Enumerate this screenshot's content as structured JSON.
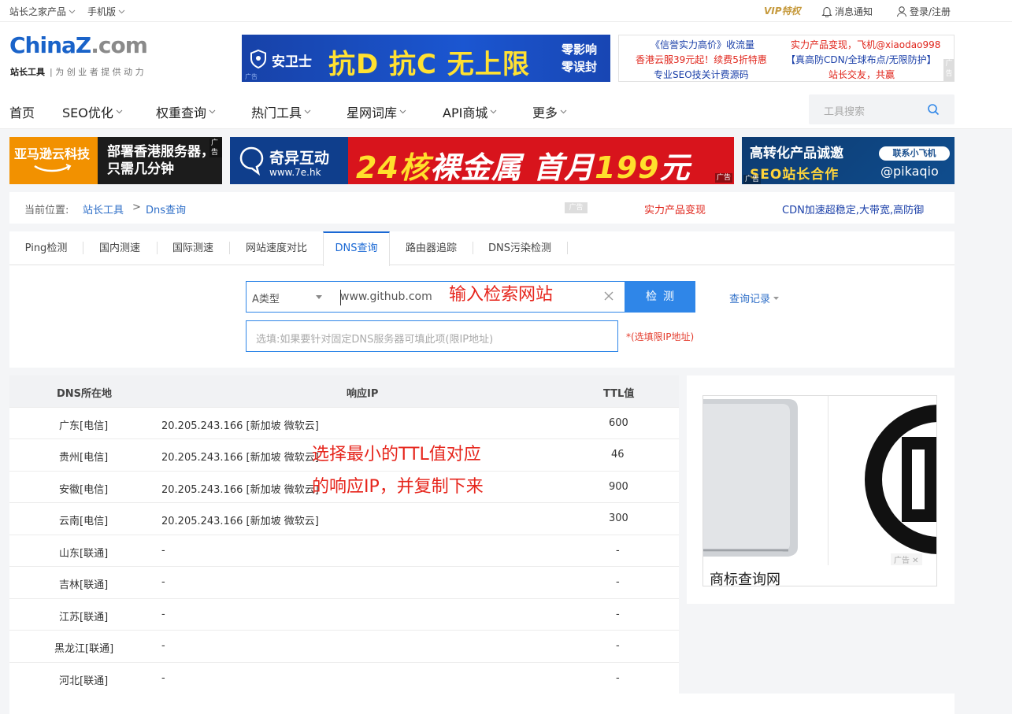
{
  "topbar": {
    "left_items": [
      "站长之家产品",
      "手机版"
    ],
    "vip": "VIP特权",
    "notify": "消息通知",
    "login": "登录/注册"
  },
  "logo": {
    "part1": "China",
    "part2": "Z",
    "part3": ".com",
    "sub_bold": "站长工具",
    "sub_text": "| 为 创 业 者 提 供 动 力"
  },
  "ads": {
    "top_banner": {
      "brand": "安卫士",
      "slogan": "抗D 抗C 无上限",
      "side1": "零影响",
      "side2": "零误封",
      "tag": "广告"
    },
    "text_links": [
      {
        "text": "《信誉实力高价》收流量",
        "color": "#1a3fa8"
      },
      {
        "text": "实力产品变现，飞机@xiaodao998",
        "color": "#e0251b"
      },
      {
        "text": "香港云服39元起！续费5折特惠",
        "color": "#e0251b"
      },
      {
        "text": "【真高防CDN/全球布点/无限防护】",
        "color": "#1a3fa8"
      },
      {
        "text": "专业SEO技关计费源码",
        "color": "#1a3fa8"
      },
      {
        "text": "站长交友，共赢",
        "color": "#e0251b"
      }
    ],
    "text_ad_mark": "广告",
    "banner1": {
      "t1": "亚马逊云科技",
      "t2a": "部署香港服务器，",
      "t2b": "只需几分钟",
      "tag": "广告"
    },
    "banner2": {
      "name": "奇异互动",
      "url": "www.7e.hk",
      "big1": "24核",
      "big2": "裸金属  首月",
      "big3": "199",
      "big4": "元",
      "tag": "广告"
    },
    "banner3": {
      "t1": "高转化产品诚邀",
      "t2": "SEO站长合作",
      "tg": "联系小飞机",
      "tw": "@pikaqio",
      "tag": "广告"
    }
  },
  "nav": {
    "items": [
      "首页",
      "SEO优化",
      "权重查询",
      "热门工具",
      "星网词库",
      "API商城",
      "更多"
    ],
    "search_placeholder": "工具搜索"
  },
  "breadcrumb": {
    "label": "当前位置:",
    "link1": "站长工具",
    "sep": ">",
    "link2": "Dns查询",
    "ad_mark": "广告",
    "promo1": "实力产品变现",
    "promo2": "CDN加速超稳定,大带宽,高防御"
  },
  "tabs": [
    "Ping检测",
    "国内测速",
    "国际测速",
    "网站速度对比",
    "DNS查询",
    "路由器追踪",
    "DNS污染检测"
  ],
  "form": {
    "record_type": "A类型",
    "domain": "www.github.com",
    "submit": "检测",
    "history": "查询记录",
    "dns_placeholder": "选填:如果要针对固定DNS服务器可填此项(限IP地址)",
    "dns_note": "*(选填限IP地址)"
  },
  "annotations": {
    "input_hint": "输入检索网站",
    "pick_line1": "选择最小的TTL值对应",
    "pick_line2": "的响应IP，并复制下来"
  },
  "table": {
    "headers": [
      "DNS所在地",
      "响应IP",
      "TTL值"
    ],
    "rows": [
      {
        "loc": "广东[电信]",
        "ip": "20.205.243.166 [新加坡 微软云]",
        "ttl": "600"
      },
      {
        "loc": "贵州[电信]",
        "ip": "20.205.243.166 [新加坡 微软云]",
        "ttl": "46"
      },
      {
        "loc": "安徽[电信]",
        "ip": "20.205.243.166 [新加坡 微软云]",
        "ttl": "900"
      },
      {
        "loc": "云南[电信]",
        "ip": "20.205.243.166 [新加坡 微软云]",
        "ttl": "300"
      },
      {
        "loc": "山东[联通]",
        "ip": "-",
        "ttl": "-"
      },
      {
        "loc": "吉林[联通]",
        "ip": "-",
        "ttl": "-"
      },
      {
        "loc": "江苏[联通]",
        "ip": "-",
        "ttl": "-"
      },
      {
        "loc": "黑龙江[联通]",
        "ip": "-",
        "ttl": "-"
      },
      {
        "loc": "河北[联通]",
        "ip": "-",
        "ttl": "-"
      }
    ]
  },
  "side_ad": {
    "caption": "商标查询网",
    "mark": "广告"
  }
}
